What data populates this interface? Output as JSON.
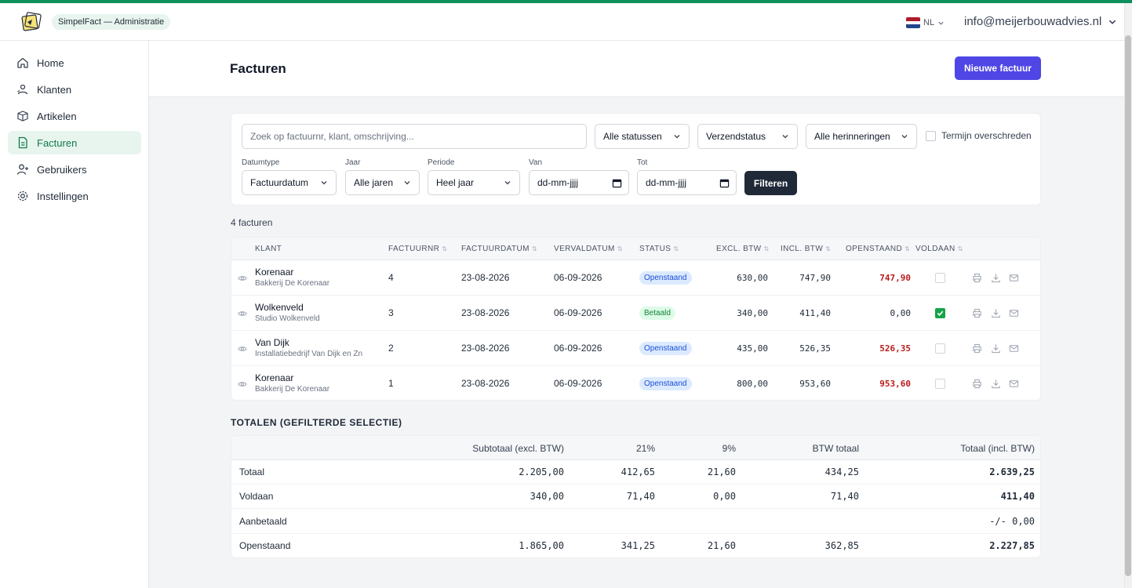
{
  "app": {
    "badge": "SimpelFact — Administratie",
    "language": "NL",
    "user_email": "info@meijerbouwadvies.nl"
  },
  "colors": {
    "accent": "#4f46e5",
    "brand": "#0f8f5c",
    "danger": "#b91c1c"
  },
  "sidebar": {
    "items": [
      {
        "label": "Home",
        "icon": "home-icon"
      },
      {
        "label": "Klanten",
        "icon": "customers-icon"
      },
      {
        "label": "Artikelen",
        "icon": "box-icon"
      },
      {
        "label": "Facturen",
        "icon": "document-icon",
        "active": true
      },
      {
        "label": "Gebruikers",
        "icon": "user-plus-icon"
      },
      {
        "label": "Instellingen",
        "icon": "gear-icon"
      }
    ]
  },
  "header": {
    "title": "Facturen",
    "new_button": "Nieuwe factuur"
  },
  "filters": {
    "search_placeholder": "Zoek op factuurnr, klant, omschrijving...",
    "status": "Alle statussen",
    "send_status": "Verzendstatus",
    "reminders": "Alle herinneringen",
    "overdue_label": "Termijn overschreden",
    "datetype_label": "Datumtype",
    "datetype": "Factuurdatum",
    "year_label": "Jaar",
    "year": "Alle jaren",
    "period_label": "Periode",
    "period": "Heel jaar",
    "from_label": "Van",
    "from_value": "dd-mm-jjjj",
    "to_label": "Tot",
    "to_value": "dd-mm-jjjj",
    "filter_button": "Filteren"
  },
  "invoices": {
    "count": "4 facturen",
    "headers": {
      "client": "KLANT",
      "number": "FACTUURNR",
      "date": "FACTUURDATUM",
      "due": "VERVALDATUM",
      "status": "STATUS",
      "excl": "EXCL. BTW",
      "incl": "INCL. BTW",
      "open": "OPENSTAAND",
      "paid": "VOLDAAN"
    },
    "rows": [
      {
        "name": "Korenaar",
        "company": "Bakkerij De Korenaar",
        "number": "4",
        "date": "23-08-2026",
        "due": "06-09-2026",
        "status": "Openstaand",
        "excl": "630,00",
        "incl": "747,90",
        "open": "747,90",
        "paid": false
      },
      {
        "name": "Wolkenveld",
        "company": "Studio Wolkenveld",
        "number": "3",
        "date": "23-08-2026",
        "due": "06-09-2026",
        "status": "Betaald",
        "excl": "340,00",
        "incl": "411,40",
        "open": "0,00",
        "paid": true
      },
      {
        "name": "Van Dijk",
        "company": "Installatiebedrijf Van Dijk en Zn",
        "number": "2",
        "date": "23-08-2026",
        "due": "06-09-2026",
        "status": "Openstaand",
        "excl": "435,00",
        "incl": "526,35",
        "open": "526,35",
        "paid": false
      },
      {
        "name": "Korenaar",
        "company": "Bakkerij De Korenaar",
        "number": "1",
        "date": "23-08-2026",
        "due": "06-09-2026",
        "status": "Openstaand",
        "excl": "800,00",
        "incl": "953,60",
        "open": "953,60",
        "paid": false
      }
    ]
  },
  "totals": {
    "title": "TOTALEN (GEFILTERDE SELECTIE)",
    "headers": {
      "subtotal": "Subtotaal (excl. BTW)",
      "vat21": "21%",
      "vat9": "9%",
      "vat_total": "BTW totaal",
      "total": "Totaal (incl. BTW)"
    },
    "rows": [
      {
        "label": "Totaal",
        "subtotal": "2.205,00",
        "vat21": "412,65",
        "vat9": "21,60",
        "vat_total": "434,25",
        "total": "2.639,25"
      },
      {
        "label": "Voldaan",
        "subtotal": "340,00",
        "vat21": "71,40",
        "vat9": "0,00",
        "vat_total": "71,40",
        "total": "411,40"
      },
      {
        "label": "Aanbetaald",
        "subtotal": "",
        "vat21": "",
        "vat9": "",
        "vat_total": "",
        "total": "-/- 0,00"
      },
      {
        "label": "Openstaand",
        "subtotal": "1.865,00",
        "vat21": "341,25",
        "vat9": "21,60",
        "vat_total": "362,85",
        "total": "2.227,85"
      }
    ]
  }
}
